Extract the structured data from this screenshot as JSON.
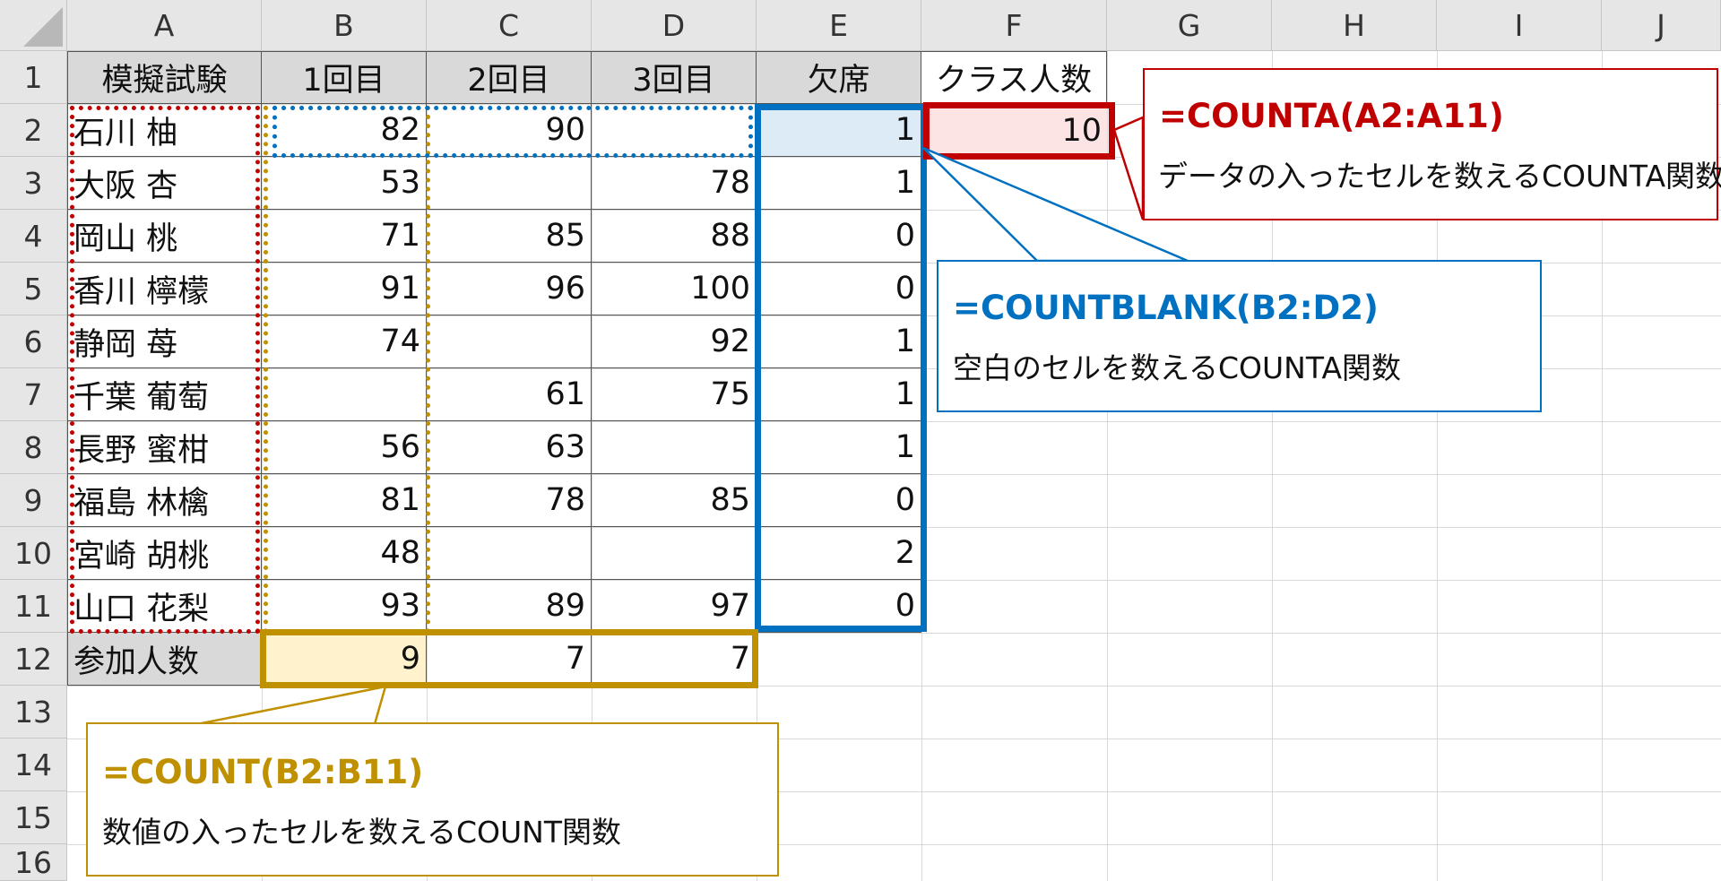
{
  "columns": [
    "A",
    "B",
    "C",
    "D",
    "E",
    "F",
    "G",
    "H",
    "I",
    "J"
  ],
  "rows": [
    "1",
    "2",
    "3",
    "4",
    "5",
    "6",
    "7",
    "8",
    "9",
    "10",
    "11",
    "12",
    "13",
    "14",
    "15",
    "16"
  ],
  "header_row": [
    "模擬試験",
    "1回目",
    "2回目",
    "3回目",
    "欠席",
    "クラス人数"
  ],
  "data_rows": [
    [
      "石川 柚",
      "82",
      "90",
      "",
      "1",
      "10"
    ],
    [
      "大阪 杏",
      "53",
      "",
      "78",
      "1",
      ""
    ],
    [
      "岡山 桃",
      "71",
      "85",
      "88",
      "0",
      ""
    ],
    [
      "香川 檸檬",
      "91",
      "96",
      "100",
      "0",
      ""
    ],
    [
      "静岡 苺",
      "74",
      "",
      "92",
      "1",
      ""
    ],
    [
      "千葉 葡萄",
      "",
      "61",
      "75",
      "1",
      ""
    ],
    [
      "長野 蜜柑",
      "56",
      "63",
      "",
      "1",
      ""
    ],
    [
      "福島 林檎",
      "81",
      "78",
      "85",
      "0",
      ""
    ],
    [
      "宮崎 胡桃",
      "48",
      "",
      "",
      "2",
      ""
    ],
    [
      "山口 花梨",
      "93",
      "89",
      "97",
      "0",
      ""
    ]
  ],
  "total_row": [
    "参加人数",
    "9",
    "7",
    "7"
  ],
  "callouts": {
    "counta": {
      "title": "=COUNTA(A2:A11)",
      "desc": "データの入ったセルを数えるCOUNTA関数"
    },
    "countblank": {
      "title": "=COUNTBLANK(B2:D2)",
      "desc": "空白のセルを数えるCOUNTA関数"
    },
    "count": {
      "title": "=COUNT(B2:B11)",
      "desc": "数値の入ったセルを数えるCOUNT関数"
    }
  },
  "colors": {
    "red": "#c00000",
    "blue": "#0070c0",
    "gold": "#bf9000"
  }
}
